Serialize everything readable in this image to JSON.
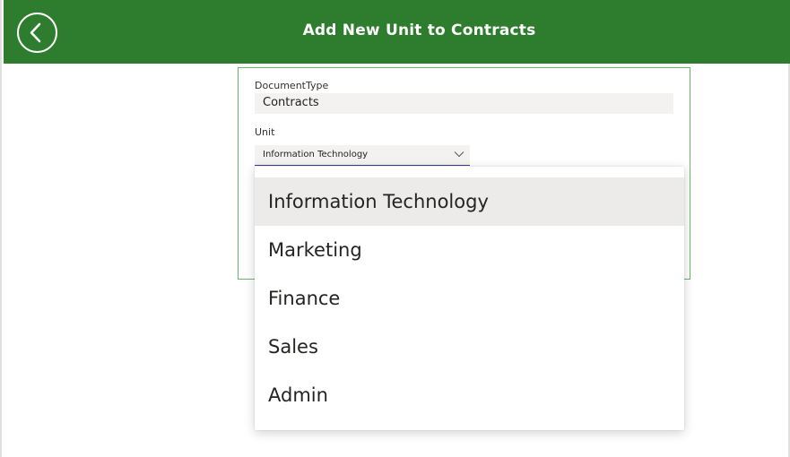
{
  "header": {
    "title": "Add New Unit to Contracts",
    "color": "#2e7d2e"
  },
  "back_button": {
    "icon": "chevron-left-icon"
  },
  "form": {
    "document_type": {
      "label": "DocumentType",
      "value": "Contracts"
    },
    "unit": {
      "label": "Unit",
      "selected": "Information Technology"
    }
  },
  "dropdown": {
    "options": [
      "Information Technology",
      "Marketing",
      "Finance",
      "Sales",
      "Admin"
    ],
    "highlighted_index": 0
  }
}
